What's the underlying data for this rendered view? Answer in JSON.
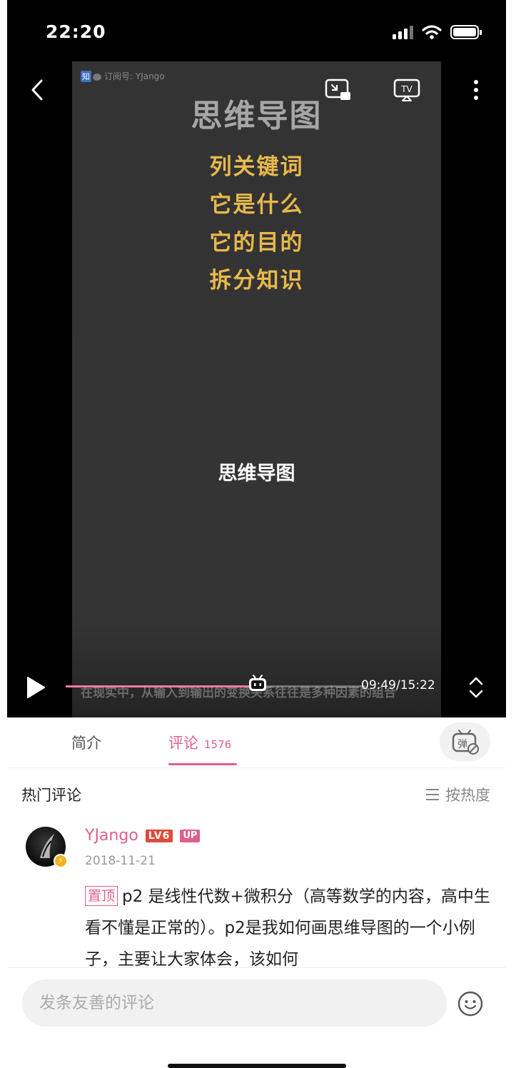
{
  "status_bar": {
    "time": "22:20"
  },
  "video": {
    "watermark_zhi": "知",
    "watermark": "订阅号: YJango",
    "title": "思维导图",
    "list": [
      "列关键词",
      "它是什么",
      "它的目的",
      "拆分知识"
    ],
    "center_text": "思维导图",
    "subtitle": "在现实中，从输入到输出的变换关系往往是多种因素的组合"
  },
  "player": {
    "progress": 0.64,
    "time_readout": "09:49/15:22",
    "accent": "#f07ca1"
  },
  "tabs": {
    "intro": "简介",
    "comments": "评论",
    "comment_count": "1576",
    "accent": "#e0608c"
  },
  "comments": {
    "section_title": "热门评论",
    "sort_label": "按热度",
    "items": [
      {
        "username": "YJango",
        "level": "LV6",
        "badge": "UP",
        "date": "2018-11-21",
        "pinned_label": "置顶",
        "text": "p2 是线性代数+微积分（高等数学的内容，高中生看不懂是正常的）。p2是我如何画思维导图的一个小例子，主要让大家体会，该如何"
      }
    ]
  },
  "input": {
    "placeholder": "发条友善的评论"
  },
  "icons": [
    "back-icon",
    "pip-icon",
    "tv-cast-icon",
    "more-icon",
    "play-icon",
    "fullscreen-icon",
    "danmaku-off-icon",
    "sort-icon",
    "emoji-icon",
    "signal-icon",
    "wifi-icon",
    "battery-icon"
  ]
}
